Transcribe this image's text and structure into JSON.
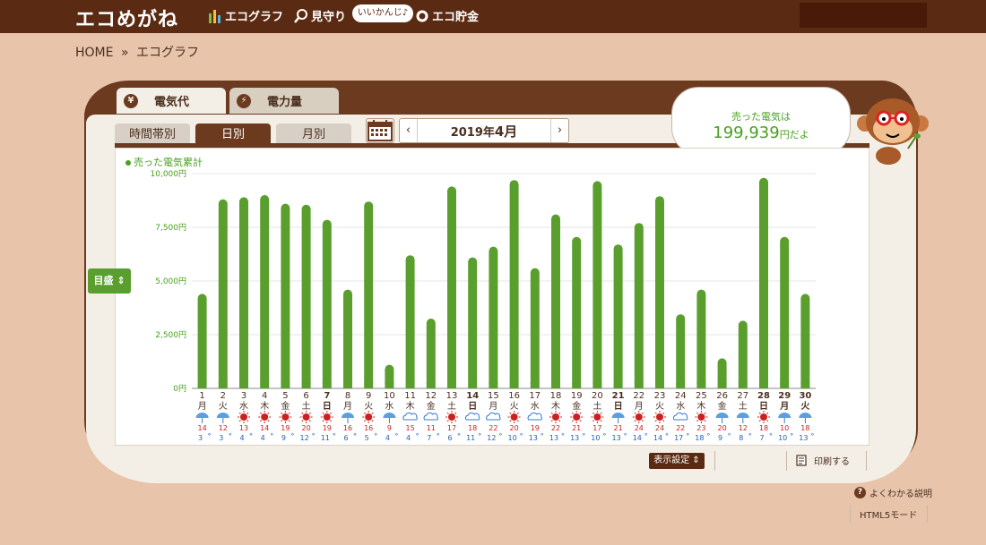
{
  "header": {
    "logo": "エコめがね",
    "nav": [
      {
        "label": "エコグラフ",
        "icon": "bar-chart-icon"
      },
      {
        "label": "見守り",
        "icon": "magnifier-icon"
      },
      {
        "label": "エコ貯金",
        "icon": "coin-icon"
      }
    ],
    "bubble_tag": "いいかんじ♪"
  },
  "breadcrumb": {
    "home": "HOME",
    "sep": "»",
    "current": "エコグラフ"
  },
  "tabs": {
    "active": "電気代",
    "inactive": "電力量"
  },
  "subtabs": [
    "時間帯別",
    "日別",
    "月別"
  ],
  "date_nav": {
    "prefix": "2019年",
    "month": "4月",
    "prev": "‹",
    "next": "›"
  },
  "speech": {
    "line1": "売った電気は",
    "amount": "199,939",
    "suffix": "円だよ"
  },
  "legend": "売った電気累計",
  "scale_button": "目盛",
  "controls": {
    "display_settings": "表示設定",
    "print": "印刷する",
    "help": "よくわかる説明",
    "html5": "HTML5モード"
  },
  "colors": {
    "bar": "#5a9e2e",
    "brown": "#6b3a1f",
    "saturday": "#3a78d0",
    "sunday": "#cc1a1a"
  },
  "chart_data": {
    "type": "bar",
    "ylim": [
      0,
      10000
    ],
    "yticks": [
      "10,000円",
      "7,500円",
      "5,000円",
      "2,500円",
      "0円"
    ],
    "categories": [
      "1",
      "2",
      "3",
      "4",
      "5",
      "6",
      "7",
      "8",
      "9",
      "10",
      "11",
      "12",
      "13",
      "14",
      "15",
      "16",
      "17",
      "18",
      "19",
      "20",
      "21",
      "22",
      "23",
      "24",
      "25",
      "26",
      "27",
      "28",
      "29",
      "30"
    ],
    "weekdays": [
      "月",
      "火",
      "水",
      "木",
      "金",
      "土",
      "日",
      "月",
      "火",
      "水",
      "木",
      "金",
      "土",
      "日",
      "月",
      "火",
      "水",
      "木",
      "金",
      "土",
      "日",
      "月",
      "火",
      "水",
      "木",
      "金",
      "土",
      "日",
      "月",
      "火"
    ],
    "values": [
      4400,
      8800,
      8900,
      9000,
      8600,
      8550,
      7850,
      4600,
      8700,
      1100,
      6200,
      3250,
      9400,
      6100,
      6600,
      9700,
      5600,
      8100,
      7050,
      9650,
      6700,
      7700,
      8950,
      3450,
      4600,
      1400,
      3150,
      9800,
      7050,
      4400
    ],
    "weather": [
      "rain",
      "rain",
      "sun",
      "sun",
      "sun",
      "sun",
      "sun",
      "rain",
      "sun",
      "rain",
      "cloud",
      "cloud",
      "sun",
      "cloud",
      "cloud",
      "sun",
      "cloud",
      "sun",
      "sun",
      "sun",
      "rain",
      "sun",
      "sun",
      "cloud",
      "sun",
      "rain",
      "rain",
      "sun",
      "rain",
      "rain"
    ],
    "high": [
      "14",
      "12",
      "13",
      "14",
      "19",
      "20",
      "19",
      "16",
      "16",
      "9",
      "15",
      "11",
      "17",
      "18",
      "22",
      "20",
      "19",
      "22",
      "21",
      "17",
      "21",
      "24",
      "24",
      "22",
      "23",
      "20",
      "12",
      "18",
      "10",
      "18"
    ],
    "low": [
      "3",
      "3",
      "4",
      "4",
      "9",
      "12",
      "11",
      "6",
      "5",
      "4",
      "4",
      "7",
      "6",
      "11",
      "12",
      "10",
      "13",
      "13",
      "13",
      "10",
      "13",
      "14",
      "14",
      "17",
      "18",
      "9",
      "8",
      "7",
      "10",
      "13"
    ]
  }
}
